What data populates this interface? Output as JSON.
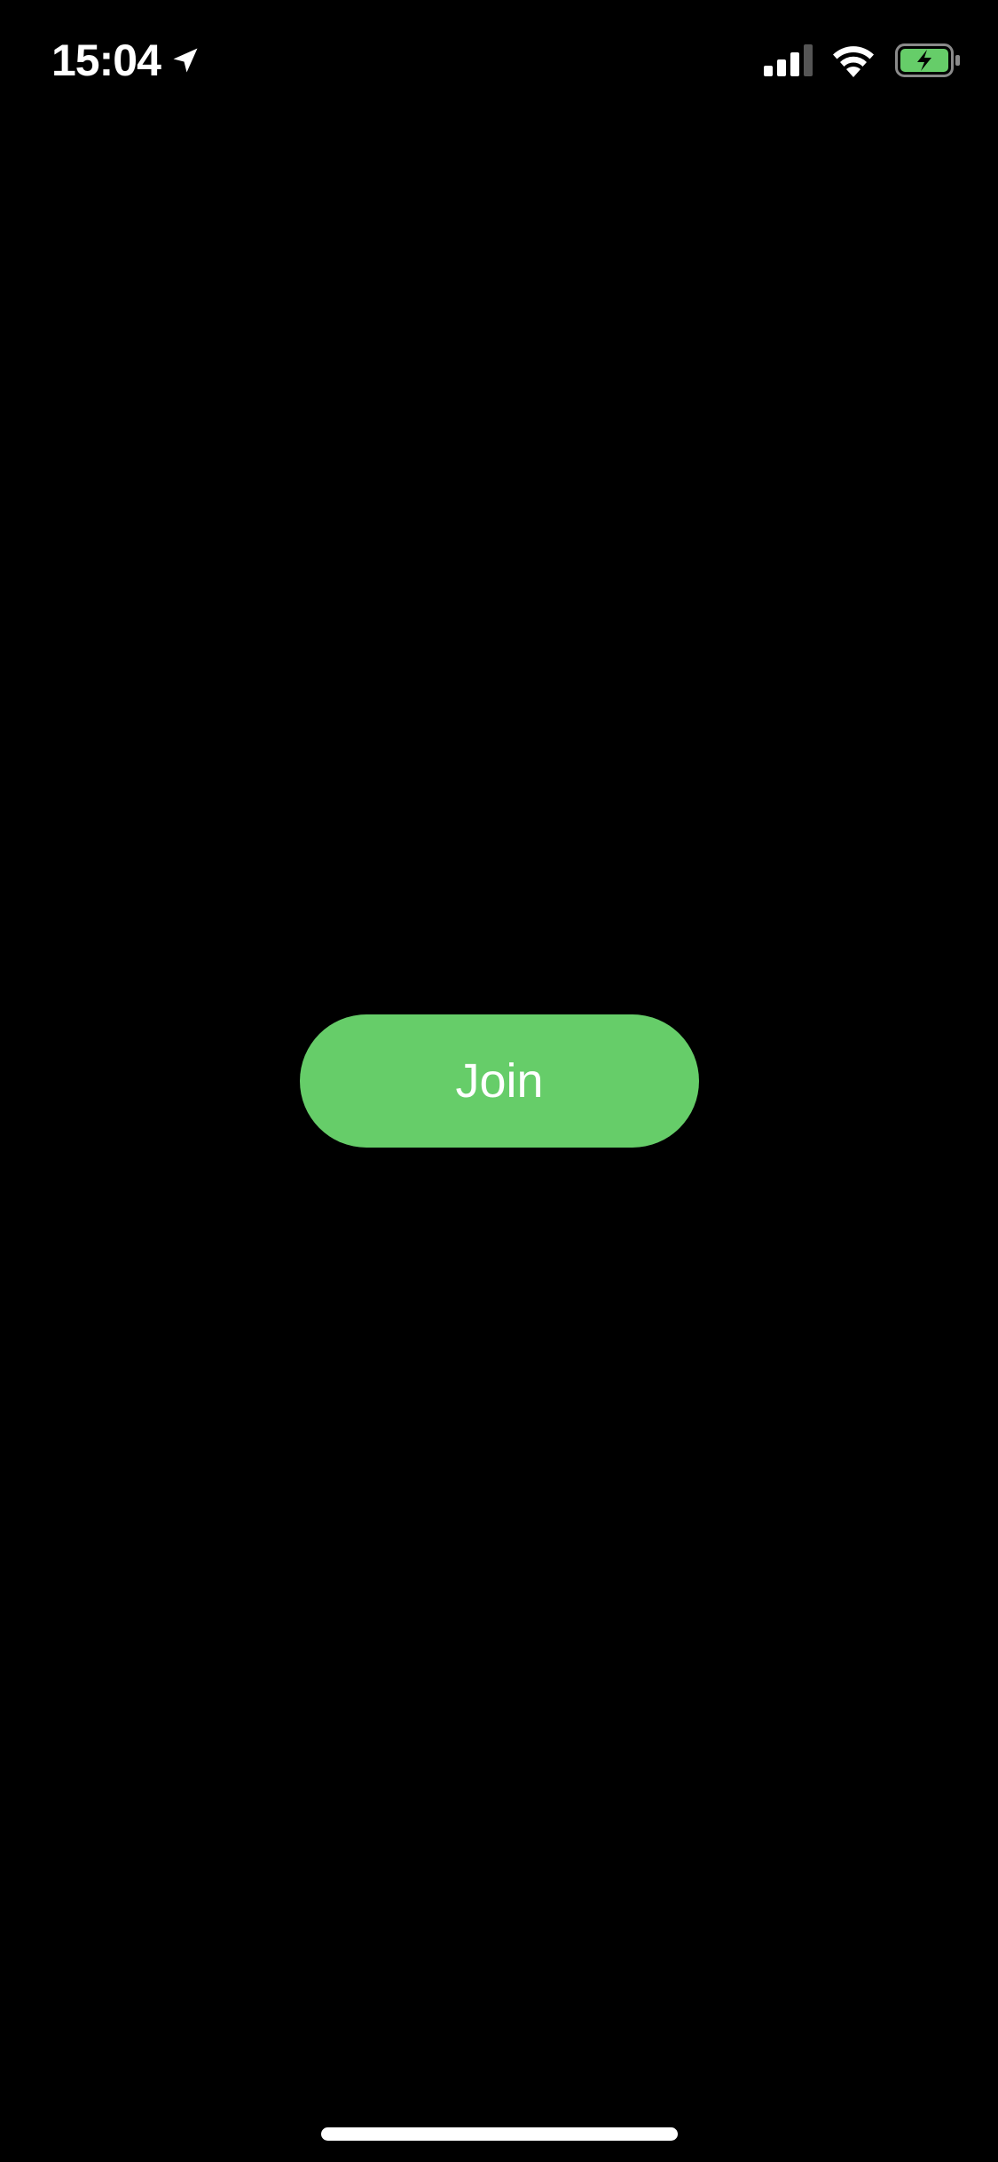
{
  "status_bar": {
    "time": "15:04",
    "icons": {
      "location": "location-arrow-icon",
      "signal": "cellular-signal-icon",
      "wifi": "wifi-icon",
      "battery": "battery-charging-icon"
    },
    "signal_bars_filled": 3,
    "signal_bars_total": 4
  },
  "main": {
    "join_label": "Join"
  },
  "colors": {
    "background": "#000000",
    "button": "#66cd69",
    "text": "#ffffff",
    "battery_fill": "#66cd69"
  }
}
